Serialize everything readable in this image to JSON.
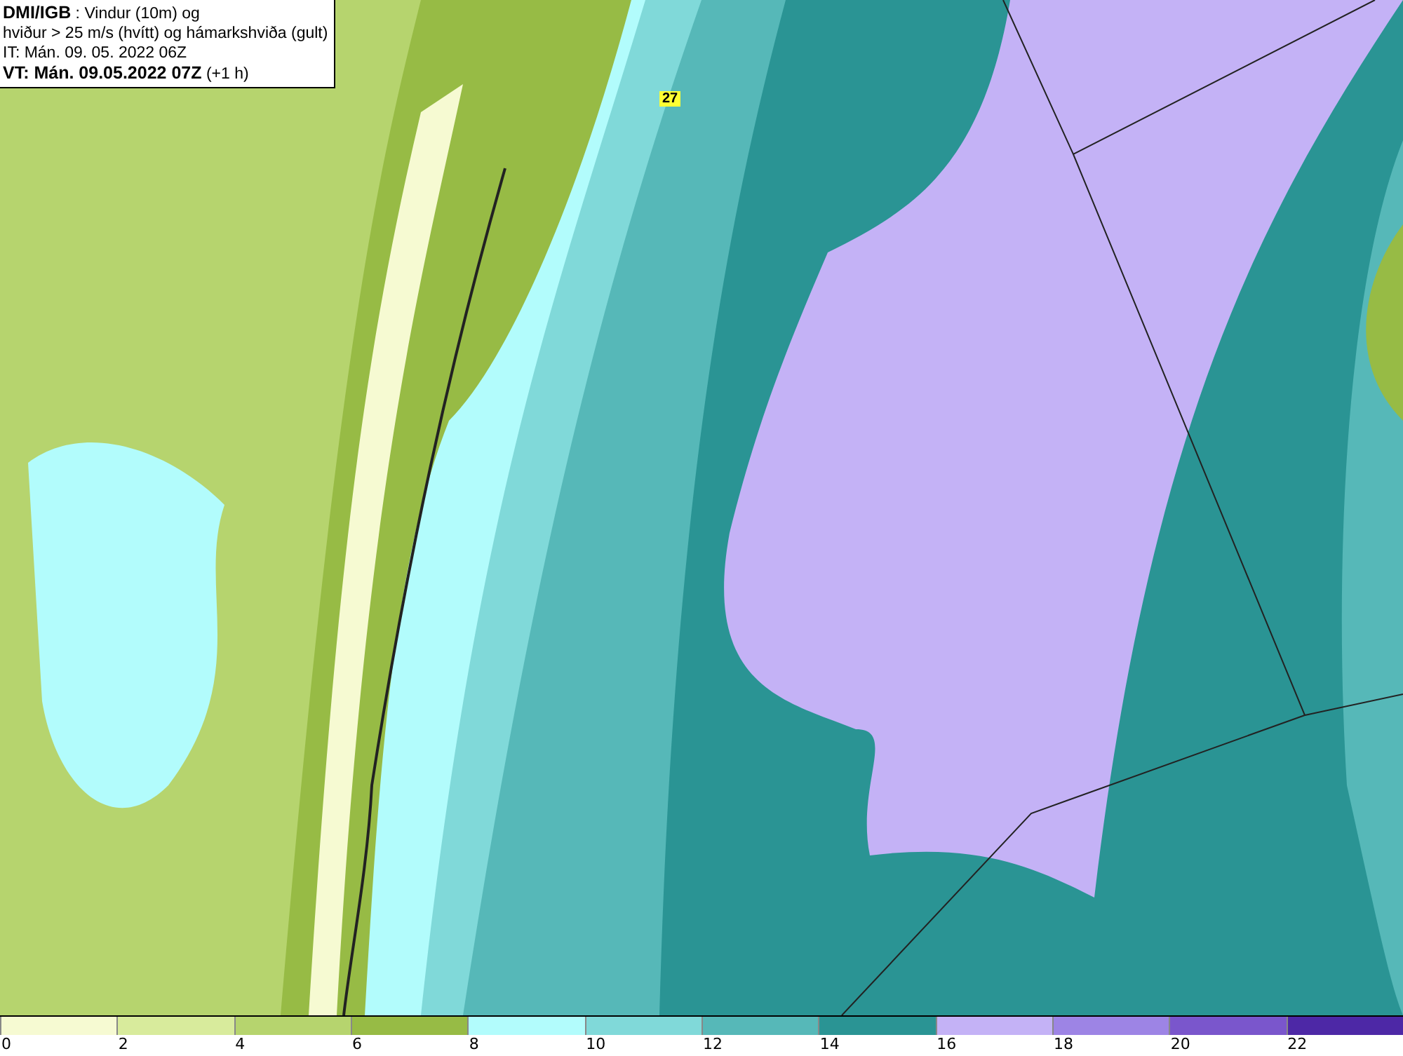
{
  "header": {
    "lines": [
      "**DMI/IGB** : Vindur (10m) og",
      "hviður > 25 m/s (hvítt) og hámarkshviða (gult)",
      "IT: Mán. 09. 05. 2022 06Z",
      "**VT: Mán. 09.05.2022 07Z** (+1 h)"
    ]
  },
  "map": {
    "gust_labels": [
      "27"
    ]
  },
  "legend": [
    {
      "label": "0",
      "color": "#f6fad2"
    },
    {
      "label": "2",
      "color": "#d8eb9c"
    },
    {
      "label": "4",
      "color": "#b6d46e"
    },
    {
      "label": "6",
      "color": "#97bb45"
    },
    {
      "label": "8",
      "color": "#b2fcfc"
    },
    {
      "label": "10",
      "color": "#80d9d9"
    },
    {
      "label": "12",
      "color": "#56b8b8"
    },
    {
      "label": "14",
      "color": "#2a9494"
    },
    {
      "label": "16",
      "color": "#c4b2f6"
    },
    {
      "label": "18",
      "color": "#9d84e5"
    },
    {
      "label": "20",
      "color": "#7a56cc"
    },
    {
      "label": "22",
      "color": "#4d28a6"
    }
  ]
}
